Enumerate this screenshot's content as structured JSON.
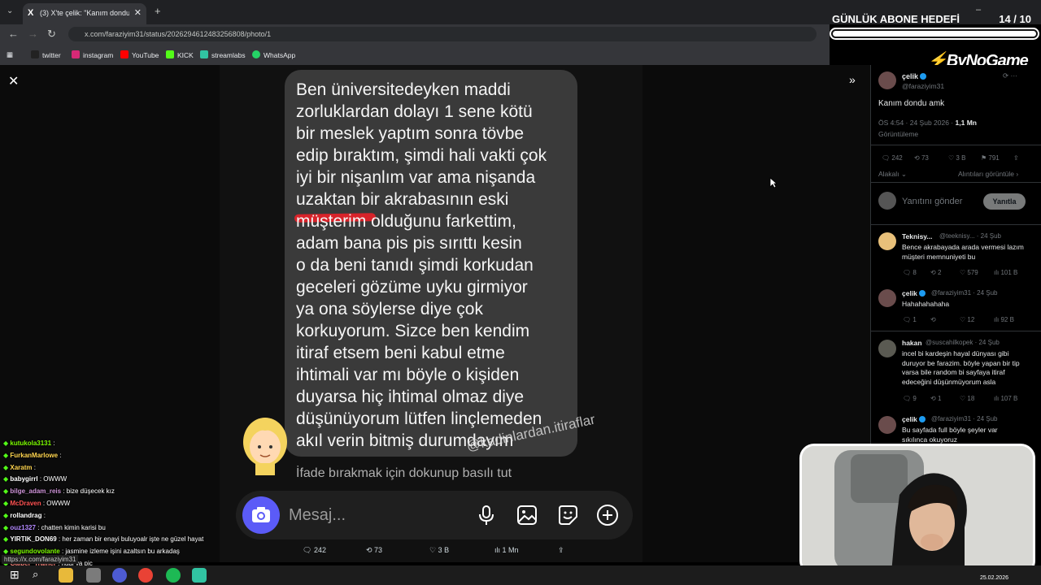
{
  "browser": {
    "tab_title": "(3) X'te çelik: \"Kanım dondu amk\"",
    "url": "x.com/faraziyim31/status/2026294612483256808/photo/1",
    "bookmarks": [
      "twitter",
      "instagram",
      "YouTube",
      "KICK",
      "streamlabs",
      "WhatsApp"
    ]
  },
  "overlay": {
    "goal_label": "GÜNLÜK ABONE HEDEFİ",
    "goal_count": "14  / 10",
    "goal_progress": 1.0,
    "brand": "ByNoGame"
  },
  "photo": {
    "message_text": "Ben üniversitedeyken maddi\nzorluklardan dolayı 1 sene kötü\nbir meslek yaptım sonra tövbe\nedip bıraktım, şimdi hali vakti çok\niyi bir nişanlım var ama nişanda\nuzaktan bir akrabasının eski\nmüşterim olduğunu farkettim,\nadam bana pis pis sırıttı kesin\no da beni tanıdı şimdi korkudan\ngeceleri gözüme uyku girmiyor\nya ona söylerse diye çok\nkorkuyorum. Sizce ben kendim\nitiraf etsem beni kabul etme\nihtimali var mı böyle o kişiden\nduyarsa hiç ihtimal olmaz diye\ndüşünüyorum lütfen linçlemeden\nakıl verin bitmiş durumdayım",
    "watermark": "@kadinlardan.itiraflar",
    "reaction_hint": "İfade bırakmak için dokunup basılı tut",
    "input_placeholder": "Mesaj..."
  },
  "action_bar": {
    "replies": "242",
    "reposts": "73",
    "likes": "3 B",
    "views": "1 Mn"
  },
  "tweet": {
    "author": "çelik",
    "handle": "@faraziyim31",
    "text": "Kanım dondu amk",
    "time": "ÖS 4:54 · 24 Şub 2026 ·",
    "views_count": "1,1 Mn",
    "views_label": "Görüntüleme",
    "replies": "242",
    "reposts": "73",
    "likes": "3 B",
    "bookmarks": "791",
    "sort_label": "Alakalı",
    "quotes_label": "Alıntıları görüntüle",
    "reply_placeholder": "Yanıtını gönder",
    "reply_button": "Yanıtla"
  },
  "replies": [
    {
      "author": "Teknisy...",
      "handle": "@teeknisy... · 24 Şub",
      "text": "Bence akrabayada arada vermesi lazım müşteri memnuniyeti bu",
      "r": "8",
      "rt": "2",
      "l": "579",
      "v": "101 B"
    },
    {
      "author": "çelik",
      "handle": "@faraziyim31 · 24 Şub",
      "text": "Hahahahahaha",
      "r": "1",
      "rt": "",
      "l": "12",
      "v": "92 B"
    },
    {
      "author": "hakan",
      "handle": "@suscahilkopek · 24 Şub",
      "text": "incel bi kardeşin hayal dünyası gibi duruyor be farazim. böyle yapan bir tip varsa bile random bi sayfaya itiraf edeceğini düşünmüyorum asla",
      "r": "9",
      "rt": "1",
      "l": "18",
      "v": "107 B"
    },
    {
      "author": "çelik",
      "handle": "@faraziyim31 · 24 Şub",
      "text": "Bu sayfada full böyle şeyler var sıkılınca okuyoruz",
      "r": "",
      "rt": "",
      "l": "",
      "v": ""
    }
  ],
  "chat": [
    {
      "user": "kutukola3131",
      "msg": ":",
      "color": "#7cfc00"
    },
    {
      "user": "FurkanMarlowe",
      "msg": ":",
      "color": "#ffd54f"
    },
    {
      "user": "Xaratm",
      "msg": ":",
      "color": "#ffd54f"
    },
    {
      "user": "babygirrl",
      "msg": ": OWWW",
      "color": "#ffffff"
    },
    {
      "user": "bilge_adam_reis",
      "msg": ": bize düşecek kız",
      "color": "#ce93d8"
    },
    {
      "user": "McDraven",
      "msg": ": OWWW",
      "color": "#ff5252"
    },
    {
      "user": "rollandrag",
      "msg": ":",
      "color": "#ffffff"
    },
    {
      "user": "ouz1327",
      "msg": ": chatten kimin karisi bu",
      "color": "#b388ff"
    },
    {
      "user": "YIRTIK_DON69",
      "msg": ": her zaman bir enayi buluyoalr işte ne güzel hayat",
      "color": "#ffffff"
    },
    {
      "user": "segundovolante",
      "msg": ": jasmine izleme işini azaltsın bu arkadaş",
      "color": "#7cfc00"
    },
    {
      "user": "Galper_Trainer",
      "msg": ": hadi ya piç",
      "color": "#ff8a80"
    }
  ],
  "status_url": "https://x.com/faraziyim31",
  "taskbar_date": "25.02.2026"
}
